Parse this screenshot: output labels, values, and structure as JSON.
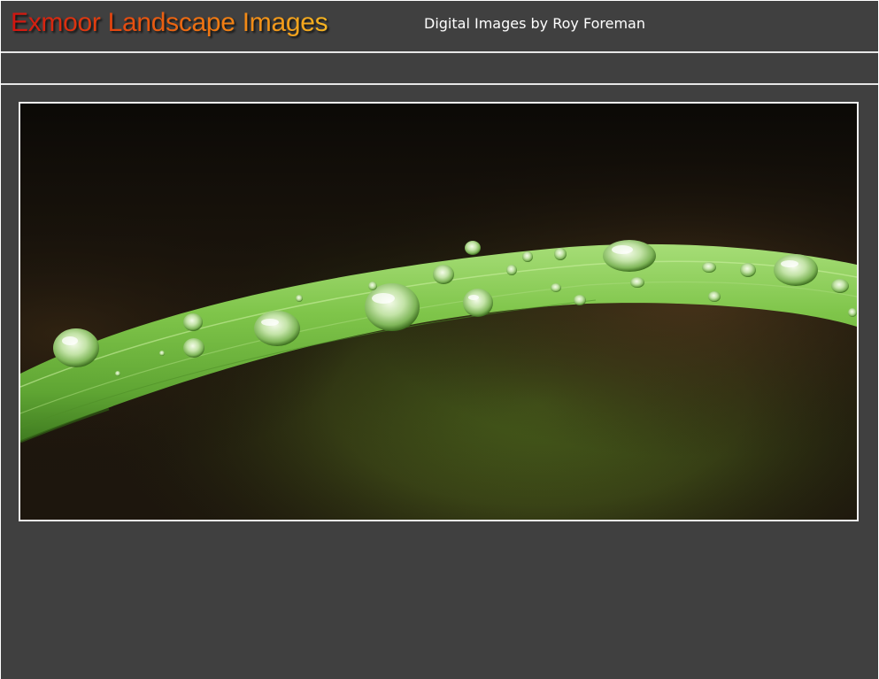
{
  "header": {
    "site_title": "Exmoor Landscape Images",
    "subtitle": "Digital Images by Roy Foreman"
  },
  "photo": {
    "subject": "grass blade with water droplets"
  },
  "colors": {
    "page_background": "#404040",
    "title_gradient_start": "#d01410",
    "title_gradient_end": "#f5b421",
    "subtitle_text": "#ffffff",
    "divider": "#e6e6e6",
    "photo_border": "#f2f2f2"
  }
}
